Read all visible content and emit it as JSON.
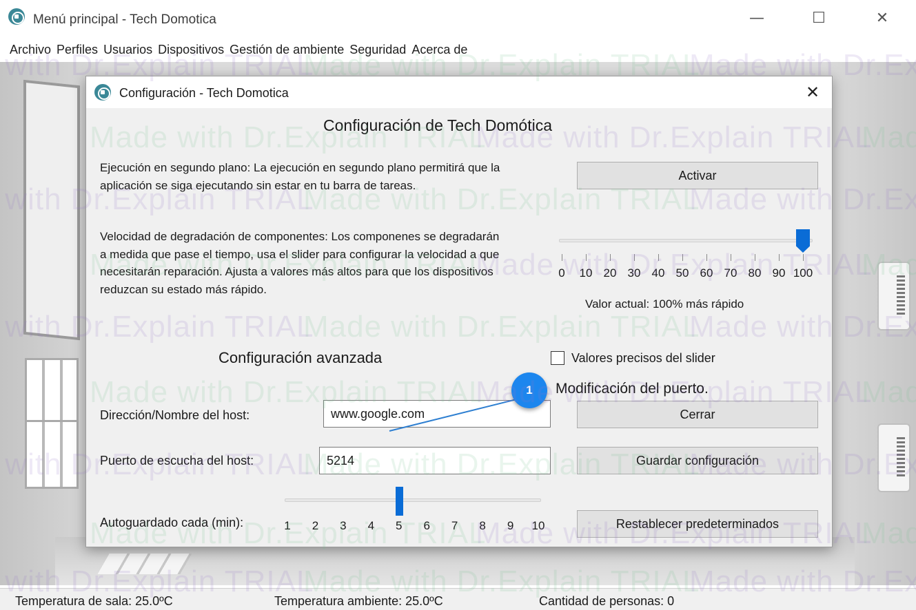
{
  "window": {
    "title": "Menú principal - Tech Domotica",
    "minimize_glyph": "—",
    "maximize_glyph": "☐",
    "close_glyph": "✕",
    "logo_icon": "house-circle-icon"
  },
  "menubar": {
    "items": [
      "Archivo",
      "Perfiles",
      "Usuarios",
      "Dispositivos",
      "Gestión de ambiente",
      "Seguridad",
      "Acerca de"
    ]
  },
  "statusbar": {
    "room_temp": "Temperatura de sala: 25.0ºC",
    "ambient_temp": "Temperatura ambiente: 25.0ºC",
    "people_count": "Cantidad de personas: 0"
  },
  "dialog": {
    "title": "Configuración - Tech Domotica",
    "close_glyph": "✕",
    "heading": "Configuración de Tech Domótica",
    "background_text": "Ejecución en segundo plano: La ejecución en segundo plano permitirá que la aplicación se siga ejecutando sin estar en tu barra de tareas.",
    "activate_button": "Activar",
    "degradation_text": "Velocidad de degradación de componentes: Los componenes se degradarán a medida que pase el tiempo, usa el slider para configurar la velocidad a que necesitarán reparación. Ajusta a valores más altos para que los dispositivos reduzcan su estado más rápido.",
    "degradation_slider": {
      "labels": [
        "0",
        "10",
        "20",
        "30",
        "40",
        "50",
        "60",
        "70",
        "80",
        "90",
        "100"
      ],
      "value": 100,
      "current_value_text": "Valor actual: 100% más rápido"
    },
    "precise_checkbox_label": "Valores precisos del slider",
    "precise_checked": false,
    "advanced_heading": "Configuración avanzada",
    "host_label": "Dirección/Nombre del host:",
    "host_value": "www.google.com",
    "port_label": "Puerto de escucha del host:",
    "port_value": "5214",
    "autosave_label": "Autoguardado cada (min):",
    "autosave_slider": {
      "labels": [
        "1",
        "2",
        "3",
        "4",
        "5",
        "6",
        "7",
        "8",
        "9",
        "10"
      ],
      "value": 5
    },
    "close_button": "Cerrar",
    "save_button": "Guardar configuración",
    "reset_button": "Restablecer predeterminados"
  },
  "annotation": {
    "badge": "1",
    "text": "Modificación del puerto.",
    "color": "#1c86ee"
  },
  "watermark": {
    "text": "Made with Dr.Explain TRIAL"
  },
  "colors": {
    "accent": "#0a6cd6",
    "dialog_bg": "#f0f0f0",
    "button_bg": "#e1e1e1"
  }
}
